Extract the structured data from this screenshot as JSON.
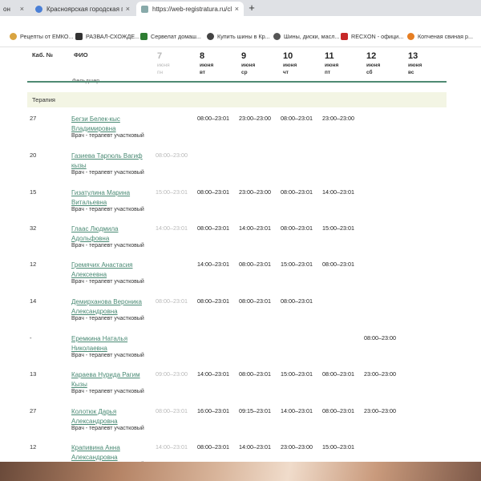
{
  "browser": {
    "tabs": [
      {
        "label": "он",
        "close": "×"
      },
      {
        "label": "Красноярская городская поликл",
        "close": "×"
      },
      {
        "label": "https://web-registratura.ru/clinic",
        "close": "×"
      }
    ],
    "new_tab": "+"
  },
  "bookmarks": [
    {
      "label": "Рецепты от ЕМКО...",
      "color": "#d9a441"
    },
    {
      "label": "РАЗВАЛ-СХОЖДЕ...",
      "color": "#333333"
    },
    {
      "label": "Сервелат домаш...",
      "color": "#2e7d32"
    },
    {
      "label": "Купить шины в Кр...",
      "color": "#444444"
    },
    {
      "label": "Шины, диски, масл...",
      "color": "#555555"
    },
    {
      "label": "RECXON - офици...",
      "color": "#c62828"
    },
    {
      "label": "Копченая свиная р...",
      "color": "#e67e22"
    }
  ],
  "table": {
    "col_room": "Каб. №",
    "col_name": "ФИО",
    "days": [
      {
        "num": "7",
        "month": "июня",
        "wd": "пн",
        "past": true
      },
      {
        "num": "8",
        "month": "июня",
        "wd": "вт",
        "past": false
      },
      {
        "num": "9",
        "month": "июня",
        "wd": "ср",
        "past": false
      },
      {
        "num": "10",
        "month": "июня",
        "wd": "чт",
        "past": false
      },
      {
        "num": "11",
        "month": "июня",
        "wd": "пт",
        "past": false
      },
      {
        "num": "12",
        "month": "июня",
        "wd": "сб",
        "past": false
      },
      {
        "num": "13",
        "month": "июня",
        "wd": "вс",
        "past": false
      }
    ],
    "hidden_position": "Фельдшер",
    "section": "Терапия",
    "rows": [
      {
        "room": "27",
        "name": "Бегзи Белек-кыс Владимировна",
        "position": "Врач - терапевт участковый",
        "slots": [
          "",
          "08:00–23:01",
          "23:00–23:00",
          "08:00–23:01",
          "23:00–23:00",
          "",
          ""
        ]
      },
      {
        "room": "20",
        "name": "Газиева Таргюль Вагиф кызы",
        "position": "Врач - терапевт участковый",
        "slots": [
          "08:00–23:00",
          "",
          "",
          "",
          "",
          "",
          ""
        ]
      },
      {
        "room": "15",
        "name": "Гизатулина Марина Витальевна",
        "position": "Врач - терапевт участковый",
        "slots": [
          "15:00–23:01",
          "08:00–23:01",
          "23:00–23:00",
          "08:00–23:01",
          "14:00–23:01",
          "",
          ""
        ]
      },
      {
        "room": "32",
        "name": "Глаас Людмила Адольфовна",
        "position": "Врач - терапевт участковый",
        "slots": [
          "14:00–23:01",
          "08:00–23:01",
          "14:00–23:01",
          "08:00–23:01",
          "15:00–23:01",
          "",
          ""
        ]
      },
      {
        "room": "12",
        "name": "Гремячих Анастасия Алексеевна",
        "position": "Врач - терапевт участковый",
        "slots": [
          "",
          "14:00–23:01",
          "08:00–23:01",
          "15:00–23:01",
          "08:00–23:01",
          "",
          ""
        ]
      },
      {
        "room": "14",
        "name": "Демирханова Вероника Александровна",
        "position": "Врач - терапевт участковый",
        "slots": [
          "08:00–23:01",
          "08:00–23:01",
          "08:00–23:01",
          "08:00–23:01",
          "",
          "",
          ""
        ]
      },
      {
        "room": "-",
        "name": "Еремкина Наталья Николаевна",
        "position": "Врач - терапевт участковый",
        "slots": [
          "",
          "",
          "",
          "",
          "",
          "08:00–23:00",
          ""
        ]
      },
      {
        "room": "13",
        "name": "Караева Нурида Рагим Кызы",
        "position": "Врач - терапевт участковый",
        "slots": [
          "09:00–23:00",
          "14:00–23:01",
          "08:00–23:01",
          "15:00–23:01",
          "08:00–23:01",
          "23:00–23:00",
          ""
        ]
      },
      {
        "room": "27",
        "name": "Колотюк Дарья Александровна",
        "position": "Врач - терапевт участковый",
        "slots": [
          "08:00–23:01",
          "16:00–23:01",
          "09:15–23:01",
          "14:00–23:01",
          "08:00–23:01",
          "23:00–23:00",
          ""
        ]
      },
      {
        "room": "12",
        "name": "Крапивина Анна Александровна",
        "position": "Врач - терапевт участковый",
        "slots": [
          "14:00–23:01",
          "08:00–23:01",
          "14:00–23:01",
          "23:00–23:00",
          "15:00–23:01",
          "",
          ""
        ]
      }
    ]
  },
  "colors": {
    "accent": "#4f8a73",
    "section_bg": "#f3f5e4",
    "link": "#4a8a74",
    "muted": "#b9b9b9"
  }
}
